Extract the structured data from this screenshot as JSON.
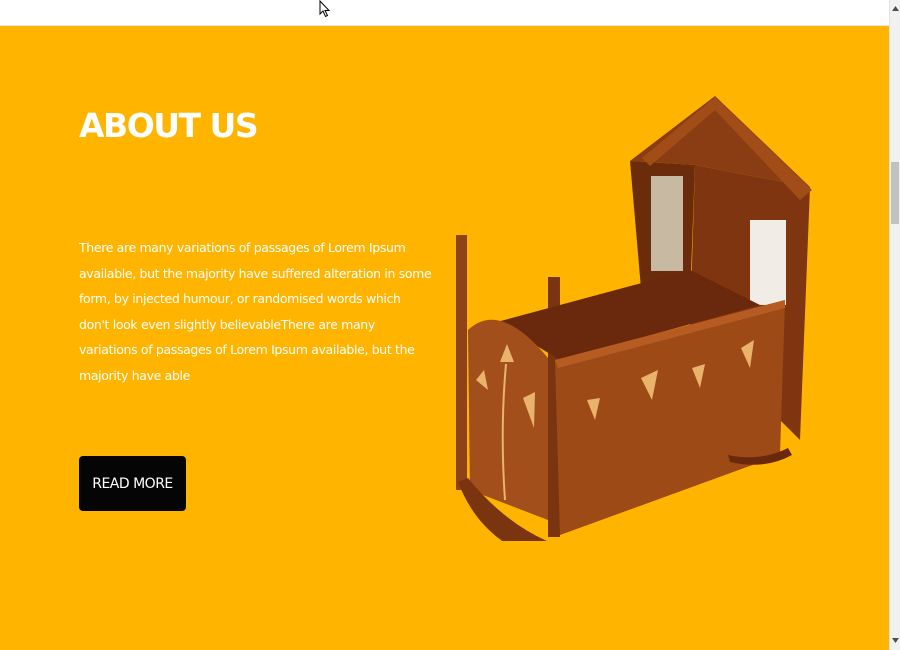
{
  "about": {
    "heading": "ABOUT US",
    "paragraph": "There are many variations of passages of Lorem Ipsum available, but the majority have suffered alteration in some form, by injected humour, or randomised words which don't look even slightly believableThere are many variations of passages of Lorem Ipsum available, but the majority have able",
    "button_label": "READ MORE",
    "image_subject": "wooden-cradle"
  },
  "colors": {
    "section_background": "#ffb400",
    "heading_text": "#ffffff",
    "button_background": "#050505",
    "button_text": "#ffffff"
  },
  "icons": {
    "cursor": "mouse-pointer-icon",
    "scroll_up": "scroll-up-arrow-icon",
    "scroll_down": "scroll-down-arrow-icon"
  }
}
